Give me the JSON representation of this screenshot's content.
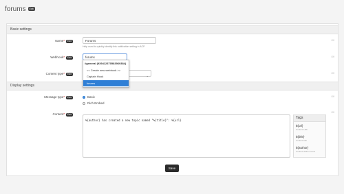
{
  "page": {
    "title": "forums",
    "title_badge": "Edit"
  },
  "sections": {
    "basic": "Basic settings",
    "display": "Display settings"
  },
  "fields": {
    "name": {
      "label": "Name",
      "badge": "Edit",
      "value": "Forums",
      "help": "Help used to quickly identify this notification setting in ACP"
    },
    "webhook": {
      "label": "Webhook",
      "badge": "Edit",
      "value": "forums"
    },
    "content_type": {
      "label": "Content type",
      "badge": "Edit"
    },
    "message_type": {
      "label": "Message type",
      "badge": "Edit",
      "options": [
        "Basic",
        "Rich Embed"
      ]
    },
    "content": {
      "label": "Content",
      "badge": "Edit",
      "value": "%{author} has created a new topic named \"%{title}\": %{url}"
    }
  },
  "webhook_dropdown": {
    "group": "#general (939412370583969384)",
    "items": [
      "<< Create new webhook >>",
      "Captain Hook",
      "forums"
    ]
  },
  "tags": {
    "header": "Tags",
    "items": [
      {
        "name": "${url}",
        "desc": "Content URL"
      },
      {
        "name": "${title}",
        "desc": "Content title"
      },
      {
        "name": "${author}",
        "desc": "Content author name"
      }
    ]
  },
  "save_label": "Save",
  "side_markers": [
    "Off",
    "Off",
    "Off",
    "Off",
    "Off",
    "Off"
  ]
}
